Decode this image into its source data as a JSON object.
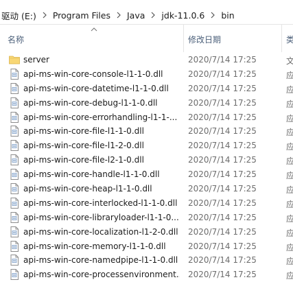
{
  "breadcrumb": {
    "items": [
      "驱动 (E:)",
      "Program Files",
      "Java",
      "jdk-11.0.6",
      "bin"
    ]
  },
  "columns": {
    "name": "名称",
    "date": "修改日期",
    "type": "类"
  },
  "files": [
    {
      "name": "server",
      "date": "2020/7/14 17:25",
      "type": "文",
      "kind": "folder-icon"
    },
    {
      "name": "api-ms-win-core-console-l1-1-0.dll",
      "date": "2020/7/14 17:25",
      "type": "应",
      "kind": "file-icon"
    },
    {
      "name": "api-ms-win-core-datetime-l1-1-0.dll",
      "date": "2020/7/14 17:25",
      "type": "应",
      "kind": "file-icon"
    },
    {
      "name": "api-ms-win-core-debug-l1-1-0.dll",
      "date": "2020/7/14 17:25",
      "type": "应",
      "kind": "file-icon"
    },
    {
      "name": "api-ms-win-core-errorhandling-l1-1-...",
      "date": "2020/7/14 17:25",
      "type": "应",
      "kind": "file-icon"
    },
    {
      "name": "api-ms-win-core-file-l1-1-0.dll",
      "date": "2020/7/14 17:25",
      "type": "应",
      "kind": "file-icon"
    },
    {
      "name": "api-ms-win-core-file-l1-2-0.dll",
      "date": "2020/7/14 17:25",
      "type": "应",
      "kind": "file-icon"
    },
    {
      "name": "api-ms-win-core-file-l2-1-0.dll",
      "date": "2020/7/14 17:25",
      "type": "应",
      "kind": "file-icon"
    },
    {
      "name": "api-ms-win-core-handle-l1-1-0.dll",
      "date": "2020/7/14 17:25",
      "type": "应",
      "kind": "file-icon"
    },
    {
      "name": "api-ms-win-core-heap-l1-1-0.dll",
      "date": "2020/7/14 17:25",
      "type": "应",
      "kind": "file-icon"
    },
    {
      "name": "api-ms-win-core-interlocked-l1-1-0.dll",
      "date": "2020/7/14 17:25",
      "type": "应",
      "kind": "file-icon"
    },
    {
      "name": "api-ms-win-core-libraryloader-l1-1-0....",
      "date": "2020/7/14 17:25",
      "type": "应",
      "kind": "file-icon"
    },
    {
      "name": "api-ms-win-core-localization-l1-2-0.dll",
      "date": "2020/7/14 17:25",
      "type": "应",
      "kind": "file-icon"
    },
    {
      "name": "api-ms-win-core-memory-l1-1-0.dll",
      "date": "2020/7/14 17:25",
      "type": "应",
      "kind": "file-icon"
    },
    {
      "name": "api-ms-win-core-namedpipe-l1-1-0.dll",
      "date": "2020/7/14 17:25",
      "type": "应",
      "kind": "file-icon"
    },
    {
      "name": "api-ms-win-core-processenvironment...",
      "date": "2020/7/14 17:25",
      "type": "应",
      "kind": "file-icon"
    }
  ],
  "colors": {
    "folder": "#f8d775",
    "header_text": "#4c607a",
    "secondary_text": "#6d6d6d"
  }
}
